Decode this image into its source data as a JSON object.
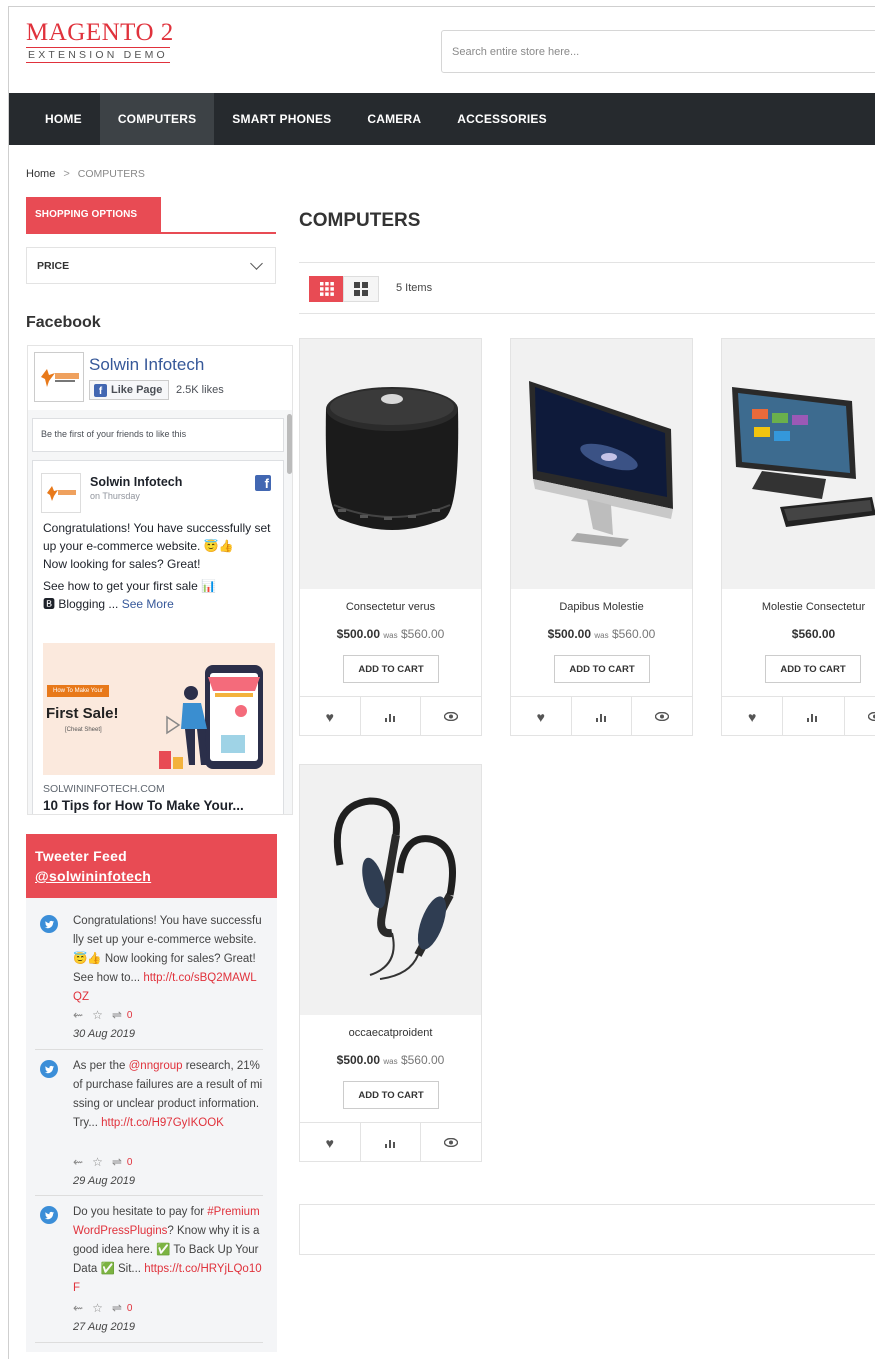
{
  "header": {
    "logo_main": "MAGENTO 2",
    "logo_sub": "EXTENSION DEMO",
    "search_placeholder": "Search entire store here..."
  },
  "nav": [
    "HOME",
    "COMPUTERS",
    "SMART PHONES",
    "CAMERA",
    "ACCESSORIES"
  ],
  "nav_active": "COMPUTERS",
  "breadcrumb": {
    "home": "Home",
    "current": "COMPUTERS"
  },
  "sidebar": {
    "shopping_options": "SHOPPING OPTIONS",
    "price_filter": "PRICE",
    "facebook_title": "Facebook"
  },
  "facebook": {
    "page_name": "Solwin Infotech",
    "like_button": "Like Page",
    "likes": "2.5K likes",
    "friends_note": "Be the first of your friends to like this",
    "post": {
      "author": "Solwin Infotech",
      "time": "on Thursday",
      "line1": "Congratulations! You have successfully set up your e-commerce website. 😇👍",
      "line2": "Now looking for sales? Great!",
      "line3": "See how to get your first sale 📊",
      "line4": "🅱 Blogging ... ",
      "see_more": "See More",
      "image_tag": "How To Make Your",
      "image_title": "First Sale!",
      "image_sub": "[Cheat Sheet]",
      "domain": "SOLWININFOTECH.COM",
      "link_title": "10 Tips for How To Make Your..."
    }
  },
  "twitter": {
    "title": "Tweeter Feed",
    "handle": "@solwininfotech",
    "tweets": [
      {
        "text": "Congratulations! You have successfully set up your e-commerce website. 😇👍 Now looking for sales? Great! See how to... ",
        "link": "http://t.co/sBQ2MAWLQZ",
        "count": "0",
        "date": "30 Aug 2019"
      },
      {
        "text_a": "As per the ",
        "mention": "@nngroup",
        "text_b": " research, 21% of purchase failures are a result of missing or unclear product information. Try... ",
        "link": "http://t.co/H97GyIKOOK",
        "count": "0",
        "date": "29 Aug 2019"
      },
      {
        "text_a": "Do you hesitate to pay for ",
        "hashtag": "#PremiumWordPressPlugins",
        "text_b": "? Know why it is a good idea here. ✅ To Back Up Your Data ✅ Sit... ",
        "link": "https://t.co/HRYjLQo10F",
        "count": "0",
        "date": "27 Aug 2019"
      }
    ]
  },
  "main": {
    "title": "COMPUTERS",
    "item_count": "5 Items",
    "was_label": "was",
    "add_to_cart": "ADD TO CART",
    "products": [
      {
        "name": "Consectetur verus",
        "price": "$500.00",
        "old_price": "$560.00"
      },
      {
        "name": "Dapibus Molestie",
        "price": "$500.00",
        "old_price": "$560.00"
      },
      {
        "name": "Molestie Consectetur",
        "price": "$560.00",
        "old_price": ""
      },
      {
        "name": "occaecatproident",
        "price": "$500.00",
        "old_price": "$560.00"
      }
    ]
  },
  "colors": {
    "accent": "#e84b54",
    "nav_bg": "#262a2e",
    "nav_active": "#3d4246",
    "link_red": "#e0323c"
  }
}
